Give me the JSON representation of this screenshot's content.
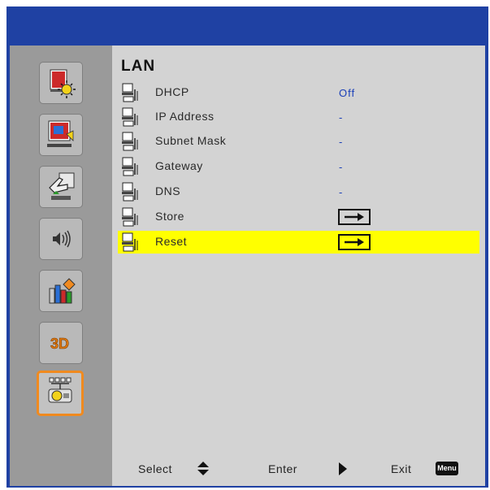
{
  "sidebar": {
    "items": [
      {
        "icon": "image-brightness-icon"
      },
      {
        "icon": "display-settings-icon"
      },
      {
        "icon": "setup-hand-icon"
      },
      {
        "icon": "volume-icon"
      },
      {
        "icon": "options-icon"
      },
      {
        "icon": "3d-icon",
        "label": "3D"
      },
      {
        "icon": "lan-network-icon",
        "active": true
      }
    ]
  },
  "menu": {
    "title": "LAN",
    "rows": [
      {
        "label": "DHCP",
        "value": "Off"
      },
      {
        "label": "IP Address",
        "value": "-"
      },
      {
        "label": "Subnet Mask",
        "value": "-"
      },
      {
        "label": "Gateway",
        "value": "-"
      },
      {
        "label": "DNS",
        "value": "-"
      },
      {
        "label": "Store",
        "value": "→"
      },
      {
        "label": "Reset",
        "value": "→",
        "selected": true
      }
    ]
  },
  "footer": {
    "select_label": "Select",
    "enter_label": "Enter",
    "exit_label": "Exit",
    "menu_key": "Menu"
  },
  "colors": {
    "frame_blue": "#1f41a3",
    "highlight": "#ffff00",
    "value_blue": "#1a3fb8",
    "active_border": "#f08a1f"
  }
}
